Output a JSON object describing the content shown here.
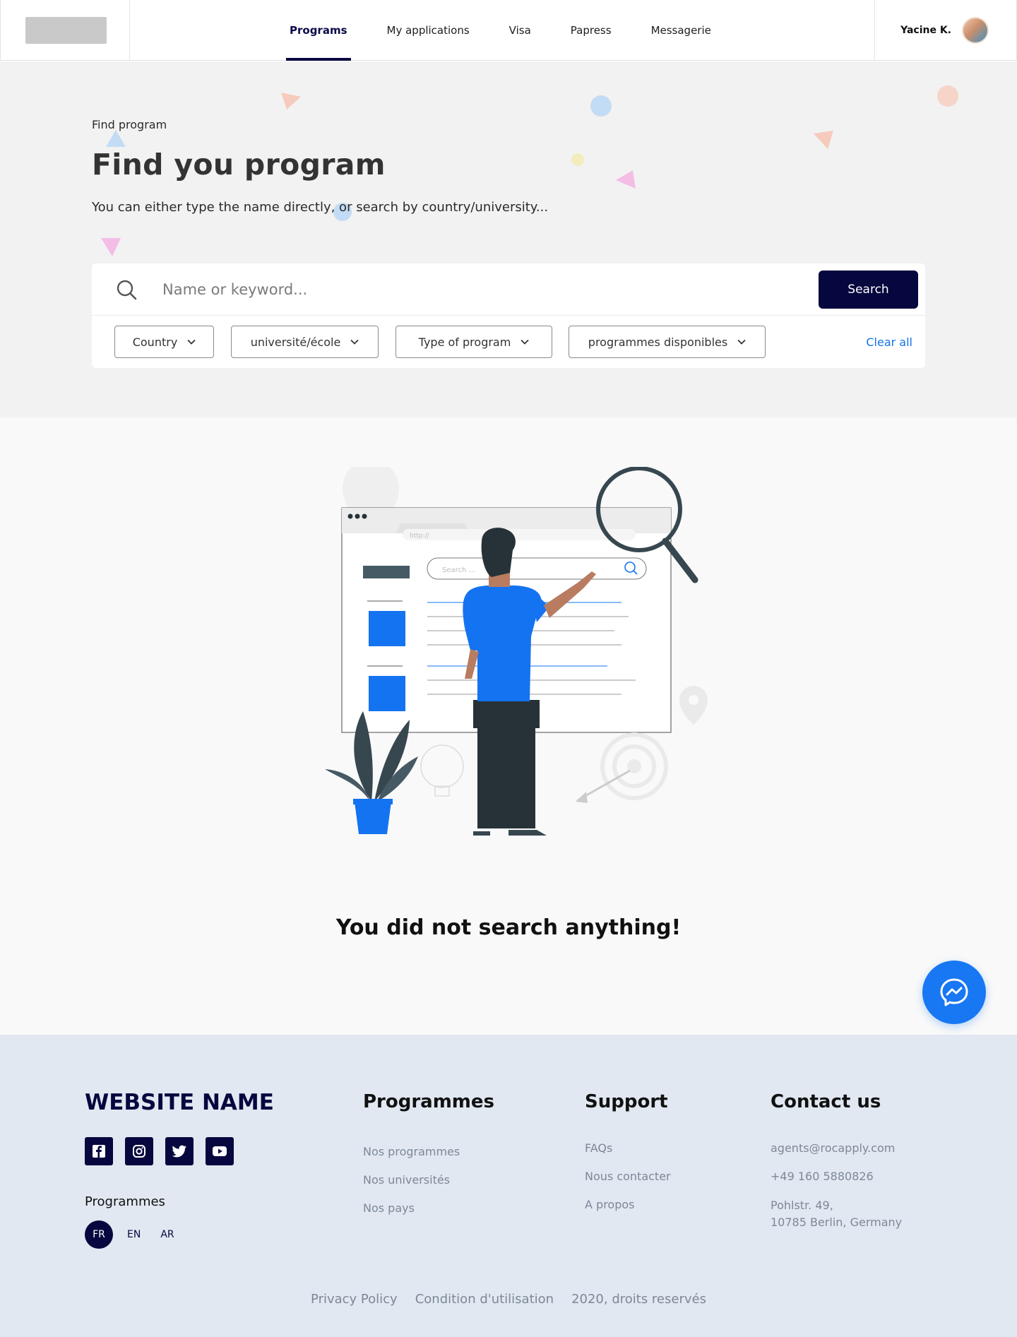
{
  "nav": {
    "items": [
      {
        "label": "Programs",
        "active": true
      },
      {
        "label": "My applications",
        "active": false
      },
      {
        "label": "Visa",
        "active": false
      },
      {
        "label": "Papress",
        "active": false
      },
      {
        "label": "Messagerie",
        "active": false
      }
    ],
    "user_name": "Yacine K."
  },
  "hero": {
    "eyebrow": "Find program",
    "title": "Find you program",
    "subtitle": "You can either type the name directly, or search by country/university..."
  },
  "search": {
    "placeholder": "Name or keyword...",
    "button_label": "Search",
    "filters": [
      "Country",
      "université/école",
      "Type of program",
      "programmes disponibles"
    ],
    "clear_all": "Clear all"
  },
  "empty_state": {
    "message": "You did not search anything!",
    "illustration_text": {
      "url": "http://",
      "search_placeholder": "Search ..."
    }
  },
  "footer": {
    "brand": "WEBSITE NAME",
    "socials": [
      "facebook-icon",
      "instagram-icon",
      "twitter-icon",
      "youtube-icon"
    ],
    "languages_title": "Programmes",
    "languages": [
      {
        "code": "FR",
        "active": true
      },
      {
        "code": "EN",
        "active": false
      },
      {
        "code": "AR",
        "active": false
      }
    ],
    "programmes": {
      "title": "Programmes",
      "links": [
        "Nos programmes",
        "Nos universités",
        "Nos pays"
      ]
    },
    "support": {
      "title": "Support",
      "links": [
        "FAQs",
        "Nous contacter",
        "A propos"
      ]
    },
    "contact": {
      "title": "Contact us",
      "email": "agents@rocapply.com",
      "phone": "+49 160 5880826",
      "address_line1": "Pohlstr. 49,",
      "address_line2": "10785 Berlin, Germany"
    },
    "bottom_links": [
      "Privacy Policy",
      "Condition d'utilisation",
      "2020, droits reservés"
    ]
  },
  "colors": {
    "primary_navy": "#07073f",
    "accent_blue": "#1473e6",
    "illustration_blue": "#1473f0",
    "messenger_blue": "#1877f2",
    "hero_bg": "#f2f2f2",
    "footer_bg": "#e1e8f1"
  }
}
